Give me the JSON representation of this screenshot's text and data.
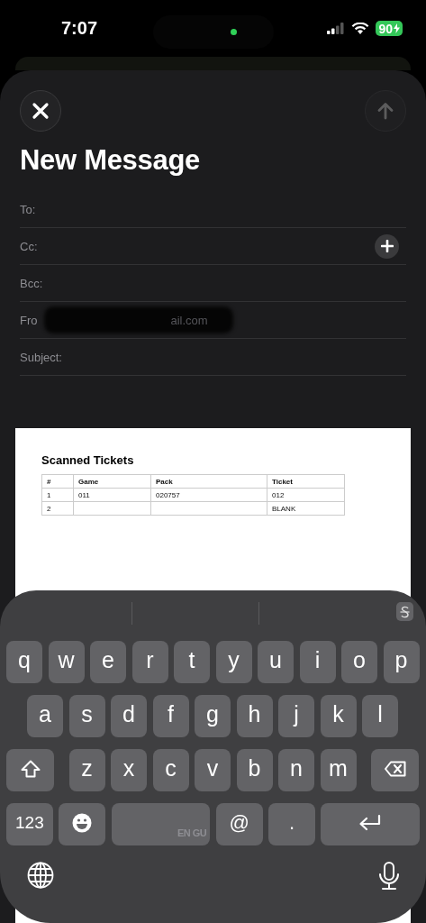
{
  "status_bar": {
    "time": "7:07",
    "battery": "90"
  },
  "compose": {
    "send_disabled": true,
    "title": "New Message",
    "fields": [
      {
        "label": "To:",
        "kind": "plain"
      },
      {
        "label": "Cc:",
        "kind": "add"
      },
      {
        "label": "Bcc:",
        "kind": "plain"
      },
      {
        "label": "Fro",
        "kind": "redacted",
        "value": "ail.com"
      },
      {
        "label": "Subject:",
        "kind": "plain"
      }
    ]
  },
  "document": {
    "title": "Scanned Tickets",
    "columns": [
      "#",
      "Game",
      "Pack",
      "Ticket"
    ],
    "rows": [
      [
        "1",
        "011",
        "020757",
        "012"
      ],
      [
        "2",
        "",
        "",
        "BLANK"
      ]
    ]
  },
  "keyboard": {
    "rows": [
      [
        "q",
        "w",
        "e",
        "r",
        "t",
        "y",
        "u",
        "i",
        "o",
        "p"
      ],
      [
        "a",
        "s",
        "d",
        "f",
        "g",
        "h",
        "j",
        "k",
        "l"
      ],
      [
        "z",
        "x",
        "c",
        "v",
        "b",
        "n",
        "m"
      ]
    ],
    "bottom": [
      {
        "kind": "numbers",
        "label": "123"
      },
      {
        "kind": "emoji"
      },
      {
        "kind": "space",
        "label": "EN GU"
      },
      {
        "kind": "char",
        "label": "@"
      },
      {
        "kind": "char",
        "label": "."
      },
      {
        "kind": "return"
      }
    ]
  }
}
